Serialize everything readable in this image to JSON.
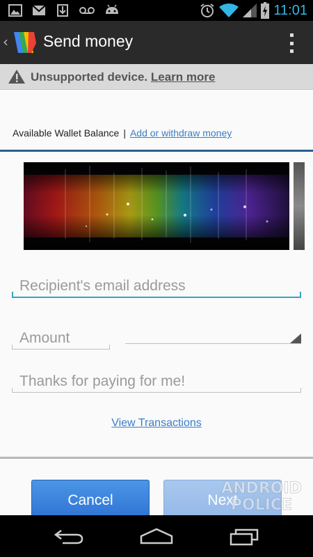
{
  "status_bar": {
    "time": "11:01",
    "left_icons": [
      "picture-icon",
      "gmail-icon",
      "download-icon",
      "voicemail-icon",
      "android-icon"
    ],
    "right_icons": [
      "alarm-icon",
      "wifi-icon",
      "signal-icon",
      "battery-icon"
    ]
  },
  "action_bar": {
    "title": "Send money",
    "back_icon": "chevron-left-icon",
    "logo": "google-wallet-logo",
    "overflow_icon": "overflow-menu-icon"
  },
  "warning": {
    "text": "Unsupported device.",
    "link": "Learn more",
    "icon": "warning-icon"
  },
  "balance": {
    "label": "Available Wallet Balance",
    "separator": "|",
    "link": "Add or withdraw money"
  },
  "form": {
    "email_placeholder": "Recipient's email address",
    "amount_placeholder": "Amount",
    "memo_value": "Thanks for paying for me!"
  },
  "links": {
    "view_transactions": "View Transactions"
  },
  "buttons": {
    "cancel": "Cancel",
    "next": "Next"
  },
  "watermark": {
    "line1": "ANDROID",
    "line2": "POLICE"
  },
  "colors": {
    "accent": "#33b5e5",
    "link": "#3a7dc8",
    "cancel_button": "#3d85de",
    "next_button": "#a0c0ec"
  }
}
